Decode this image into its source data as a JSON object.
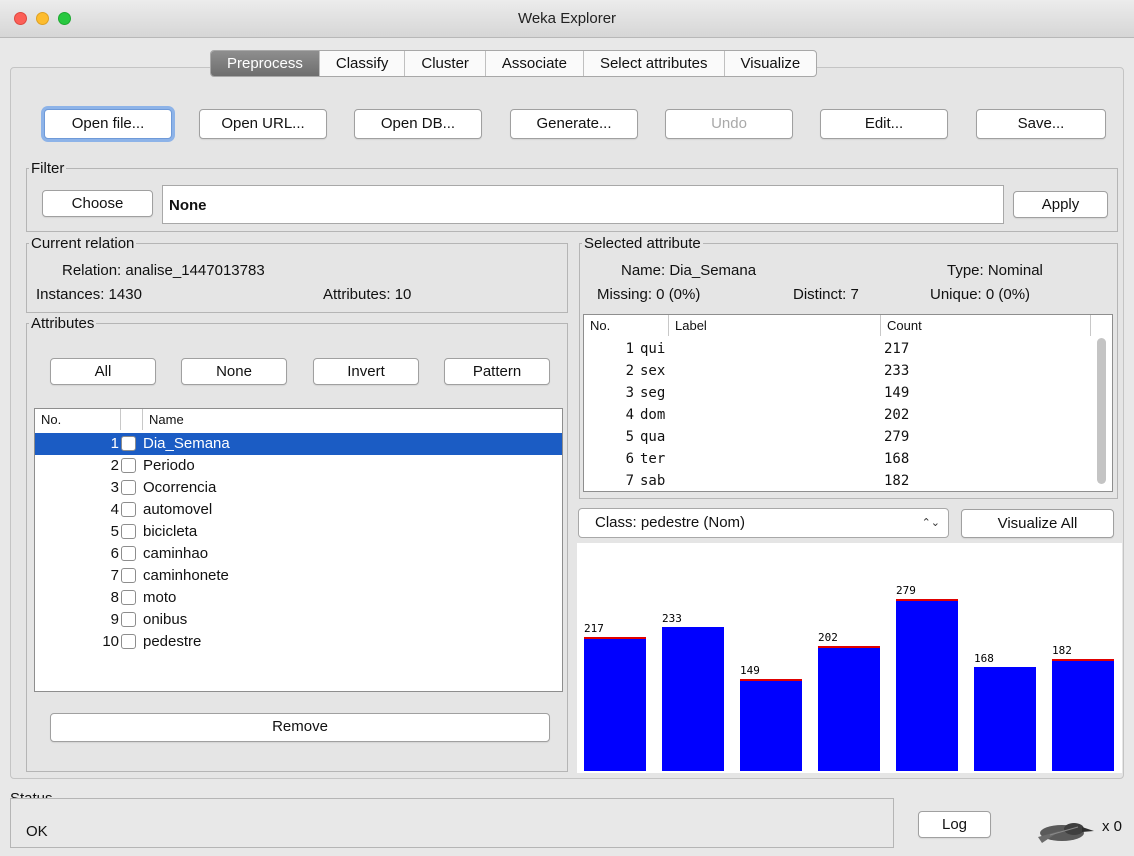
{
  "window": {
    "title": "Weka Explorer"
  },
  "tabs": [
    {
      "label": "Preprocess"
    },
    {
      "label": "Classify"
    },
    {
      "label": "Cluster"
    },
    {
      "label": "Associate"
    },
    {
      "label": "Select attributes"
    },
    {
      "label": "Visualize"
    }
  ],
  "toolbar": {
    "open_file": "Open file...",
    "open_url": "Open URL...",
    "open_db": "Open DB...",
    "generate": "Generate...",
    "undo": "Undo",
    "edit": "Edit...",
    "save": "Save..."
  },
  "filter": {
    "legend": "Filter",
    "choose": "Choose",
    "value": "None",
    "apply": "Apply"
  },
  "current_relation": {
    "legend": "Current relation",
    "relation": "Relation: analise_1447013783",
    "instances": "Instances: 1430",
    "attributes": "Attributes: 10"
  },
  "attributes": {
    "legend": "Attributes",
    "all": "All",
    "none": "None",
    "invert": "Invert",
    "pattern": "Pattern",
    "col_no": "No.",
    "col_name": "Name",
    "rows": [
      {
        "no": "1",
        "name": "Dia_Semana"
      },
      {
        "no": "2",
        "name": "Periodo"
      },
      {
        "no": "3",
        "name": "Ocorrencia"
      },
      {
        "no": "4",
        "name": "automovel"
      },
      {
        "no": "5",
        "name": "bicicleta"
      },
      {
        "no": "6",
        "name": "caminhao"
      },
      {
        "no": "7",
        "name": "caminhonete"
      },
      {
        "no": "8",
        "name": "moto"
      },
      {
        "no": "9",
        "name": "onibus"
      },
      {
        "no": "10",
        "name": "pedestre"
      }
    ],
    "remove": "Remove"
  },
  "selected_attribute": {
    "legend": "Selected attribute",
    "name": "Name: Dia_Semana",
    "type": "Type: Nominal",
    "missing": "Missing: 0 (0%)",
    "distinct": "Distinct: 7",
    "unique": "Unique: 0 (0%)",
    "col_no": "No.",
    "col_label": "Label",
    "col_count": "Count",
    "rows": [
      {
        "no": "1",
        "label": "qui",
        "count": "217"
      },
      {
        "no": "2",
        "label": "sex",
        "count": "233"
      },
      {
        "no": "3",
        "label": "seg",
        "count": "149"
      },
      {
        "no": "4",
        "label": "dom",
        "count": "202"
      },
      {
        "no": "5",
        "label": "qua",
        "count": "279"
      },
      {
        "no": "6",
        "label": "ter",
        "count": "168"
      },
      {
        "no": "7",
        "label": "sab",
        "count": "182"
      }
    ]
  },
  "class_select": {
    "value": "Class: pedestre (Nom)",
    "arrows": "⌃⌄"
  },
  "visualize_all": "Visualize All",
  "histogram": {
    "counts": [
      217,
      233,
      149,
      202,
      279,
      168,
      182
    ],
    "labels": [
      "217",
      "233",
      "149",
      "202",
      "279",
      "168",
      "182"
    ],
    "red_top": [
      true,
      false,
      true,
      true,
      true,
      false,
      true
    ],
    "max": 279,
    "bar_color": "#0000ff",
    "class_color": "#e00000"
  },
  "status": {
    "legend": "Status",
    "text": "OK",
    "log": "Log",
    "x_count": "x 0"
  }
}
